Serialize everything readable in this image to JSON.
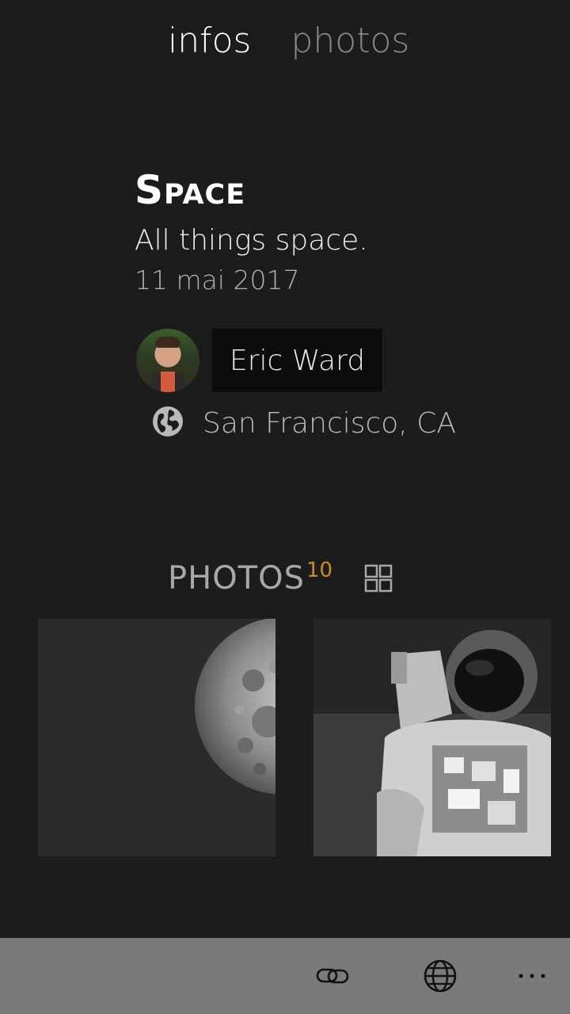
{
  "pivot": {
    "tabs": [
      {
        "label": "infos"
      },
      {
        "label": "photos"
      }
    ]
  },
  "album": {
    "title": "Space",
    "description": "All things space.",
    "date": "11 mai 2017"
  },
  "author": {
    "name": "Eric Ward",
    "location": "San Francisco, CA"
  },
  "photos": {
    "title": "PHOTOS",
    "count": "10"
  },
  "colors": {
    "accent": "#c98d1a",
    "background": "#1c1c1c",
    "appbar": "#7a7a7a"
  },
  "appbar": {
    "icons": [
      "link-icon",
      "globe-icon",
      "more-icon"
    ]
  }
}
